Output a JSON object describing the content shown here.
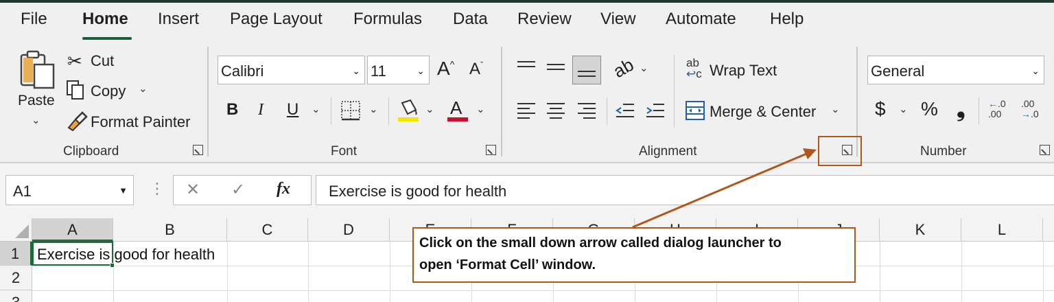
{
  "menu": {
    "tabs": [
      "File",
      "Home",
      "Insert",
      "Page Layout",
      "Formulas",
      "Data",
      "Review",
      "View",
      "Automate",
      "Help"
    ],
    "active_tab": "Home"
  },
  "clipboard": {
    "paste": "Paste",
    "cut": "Cut",
    "copy": "Copy",
    "format_painter": "Format Painter",
    "group_label": "Clipboard"
  },
  "font": {
    "name": "Calibri",
    "size": "11",
    "bold": "B",
    "italic": "I",
    "underline": "U",
    "font_color_glyph": "A",
    "grow_glyph": "A",
    "shrink_glyph": "A",
    "group_label": "Font",
    "highlight_color": "#f5e400",
    "font_color": "#c8102e"
  },
  "alignment": {
    "wrap_text": "Wrap Text",
    "merge_center": "Merge & Center",
    "group_label": "Alignment"
  },
  "number": {
    "format": "General",
    "currency": "$",
    "percent": "%",
    "comma": "❟",
    "group_label": "Number"
  },
  "formula_bar": {
    "name_box": "A1",
    "fx": "fx",
    "cancel": "✕",
    "enter": "✓",
    "content": "Exercise is good for health"
  },
  "grid": {
    "columns": [
      "A",
      "B",
      "C",
      "D",
      "E",
      "F",
      "G",
      "H",
      "I",
      "J",
      "K",
      "L"
    ],
    "rows": [
      "1",
      "2",
      "3"
    ],
    "cell_a1": "Exercise is good for health"
  },
  "annotation": {
    "line1": "Click on the small down arrow called dialog launcher to",
    "line2": "open ‘Format Cell’ window.",
    "color": "#b1561b"
  },
  "colors": {
    "accent_green": "#1e6b3a",
    "ribbon_bg": "#f0f0f0"
  }
}
